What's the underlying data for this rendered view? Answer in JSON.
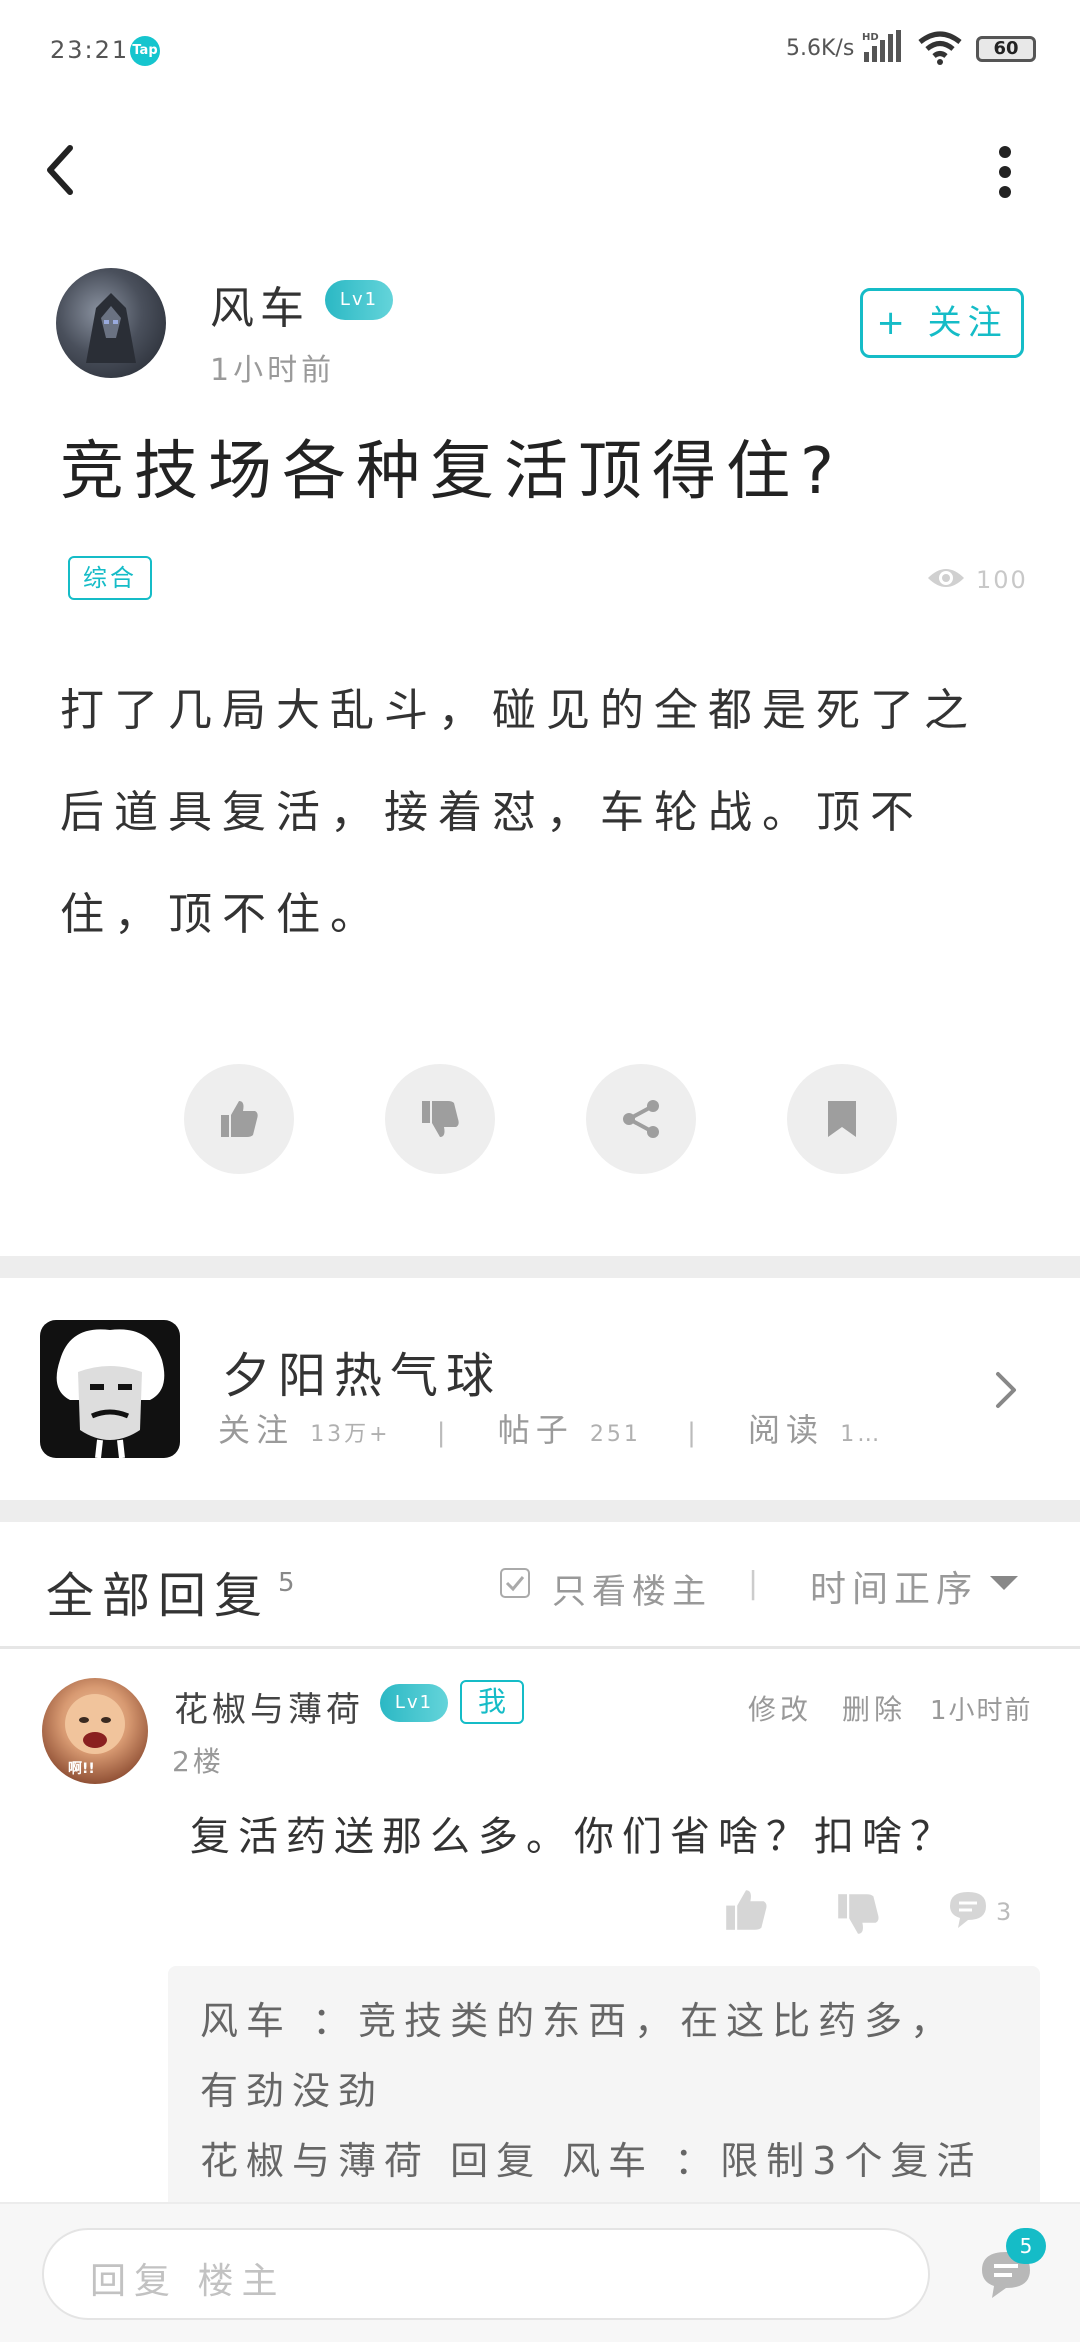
{
  "status_bar": {
    "time": "23:21",
    "app_badge": "Tap",
    "net_speed": "5.6K/s",
    "battery": "60"
  },
  "nav": {
    "back_icon": "back-arrow-icon",
    "more_icon": "more-vertical-icon"
  },
  "post": {
    "author": "风车",
    "level": "Lv1",
    "time": "1小时前",
    "follow_label": "+ 关注",
    "title": "竞技场各种复活顶得住?",
    "tag": "综合",
    "views": "100",
    "body": "打了几局大乱斗，碰见的全都是死了之后道具复活，接着怼，车轮战。顶不住，顶不住。"
  },
  "actions": [
    "like-icon",
    "dislike-icon",
    "share-icon",
    "bookmark-icon"
  ],
  "forum": {
    "name": "夕阳热气球",
    "followers_label": "关注",
    "followers": "13万+",
    "posts_label": "帖子",
    "posts": "251",
    "reads_label": "阅读",
    "reads": "1…"
  },
  "replies_header": {
    "title": "全部回复",
    "count": "5",
    "only_op": "只看楼主",
    "separator": "|",
    "sort": "时间正序"
  },
  "reply": {
    "name": "花椒与薄荷",
    "level": "Lv1",
    "me_badge": "我",
    "avatar_text": "啊!!",
    "edit": "修改",
    "delete": "删除",
    "time": "1小时前",
    "floor": "2楼",
    "body": "复活药送那么多。你们省啥？扣啥？",
    "comment_count": "3",
    "sub_replies": [
      {
        "line": "风车 ：竞技类的东西，在这比药多，"
      },
      {
        "line": "有劲没劲"
      },
      {
        "line": "花椒与薄荷 回复 风车 ：限制3个复活"
      }
    ]
  },
  "bottom_bar": {
    "placeholder": "回复 楼主",
    "message_badge": "5"
  },
  "colors": {
    "accent": "#15bcc7",
    "divider": "#ededed"
  }
}
